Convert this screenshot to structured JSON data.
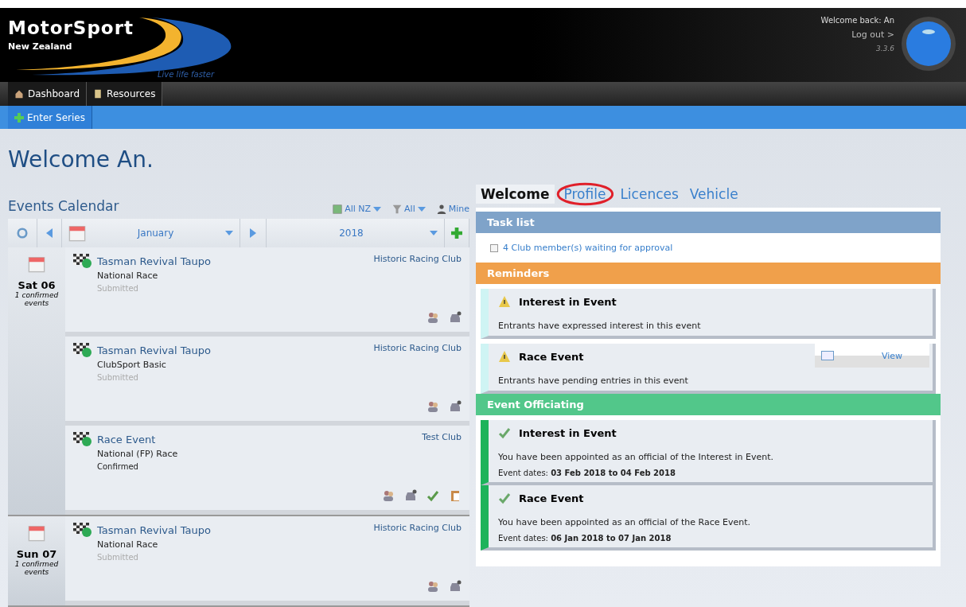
{
  "header": {
    "brand": "MotorSport",
    "subbrand": "New Zealand",
    "tagline": "Live life faster",
    "greeting": "Welcome back: An",
    "logout": "Log out >",
    "version": "3.3.6"
  },
  "nav": [
    {
      "label": "Dashboard",
      "selected": false
    },
    {
      "label": "Resources",
      "selected": false
    }
  ],
  "subnav": [
    {
      "label": "Enter Series"
    }
  ],
  "page_title": "Welcome An.",
  "calendar": {
    "title": "Events Calendar",
    "filters": [
      {
        "label": "All NZ",
        "dropdown": true
      },
      {
        "label": "All",
        "dropdown": true
      },
      {
        "label": "Mine",
        "dropdown": false
      }
    ],
    "month": "January",
    "year": "2018",
    "days": [
      {
        "date": "Sat 06",
        "note": "1 confirmed events",
        "events": [
          {
            "title": "Tasman Revival Taupo",
            "club": "Historic Racing Club",
            "type": "National Race",
            "status": "Submitted",
            "confirmed": false
          },
          {
            "title": "Tasman Revival Taupo",
            "club": "Historic Racing Club",
            "type": "ClubSport Basic",
            "status": "Submitted",
            "confirmed": false
          },
          {
            "title": "Race Event",
            "club": "Test Club",
            "type": "National (FP) Race",
            "status": "Confirmed",
            "confirmed": true
          }
        ]
      },
      {
        "date": "Sun 07",
        "note": "1 confirmed events",
        "events": [
          {
            "title": "Tasman Revival Taupo",
            "club": "Historic Racing Club",
            "type": "National Race",
            "status": "Submitted",
            "confirmed": false
          }
        ]
      }
    ]
  },
  "tabs": [
    {
      "label": "Welcome",
      "selected": true,
      "circled": false
    },
    {
      "label": "Profile",
      "selected": false,
      "circled": true
    },
    {
      "label": "Licences",
      "selected": false,
      "circled": false
    },
    {
      "label": "Vehicle",
      "selected": false,
      "circled": false
    }
  ],
  "sections": [
    {
      "title": "Task list",
      "color": "#7fa3c9",
      "kind": "tasks",
      "tasks": [
        {
          "label": "4 Club member(s) waiting for approval",
          "checked": false
        }
      ]
    },
    {
      "title": "Reminders",
      "color": "#f0a04b",
      "kind": "cards",
      "cards": [
        {
          "kind": "warning",
          "title": "Interest in Event",
          "text": "Entrants have expressed interest in this event"
        },
        {
          "kind": "warning",
          "title": "Race Event",
          "text": "Entrants have pending entries in this event",
          "action": "View"
        }
      ]
    },
    {
      "title": "Event Officiating",
      "color": "#52c78a",
      "kind": "cards",
      "cards": [
        {
          "kind": "check",
          "title": "Interest in Event",
          "text": "You have been appointed as an official of the Interest in Event.",
          "dates": "Event dates: **03 Feb 2018 to 04 Feb 2018**"
        },
        {
          "kind": "check",
          "title": "Race Event",
          "text": "You have been appointed as an official of the Race Event.",
          "dates": "Event dates: **06 Jan 2018 to 07 Jan 2018**"
        }
      ]
    }
  ]
}
